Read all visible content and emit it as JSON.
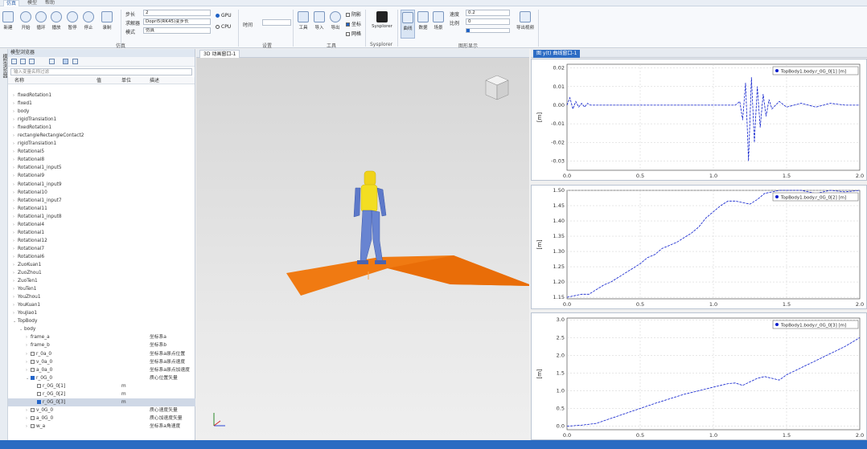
{
  "ribbon": {
    "tabs": [
      "仿真",
      "模型",
      "帮助"
    ],
    "buttons": {
      "new": "新建",
      "start": "开始",
      "loop": "循环",
      "play": "播放",
      "pause": "暂停",
      "stop": "停止",
      "record": "录制"
    },
    "fields": {
      "step_label": "步长",
      "step_value": "2",
      "solver_label": "求解器",
      "solver_value": "Dopri5(RK45)变步长",
      "mode_label": "模式",
      "mode_value": "仿真",
      "time_label": "时间",
      "time_value": ""
    },
    "radios": {
      "gpu": "GPU",
      "cpu": "CPU"
    },
    "mid_buttons": {
      "tools": "工具",
      "import": "导入",
      "export": "导出"
    },
    "checks": [
      "阴影",
      "坐标",
      "网格"
    ],
    "right_buttons": {
      "sysplorer": "Sysplorer",
      "plot": "曲线",
      "data": "数据",
      "scene": "场景"
    },
    "speed_label": "速度",
    "speed_value": "0.2",
    "scale_label": "比例",
    "scale_value": "0",
    "extra_button": "导出视频",
    "groups": [
      "仿真",
      "设置",
      "工具",
      "Sysplorer",
      "图形显示"
    ]
  },
  "tree": {
    "panel_title": "模型浏览器",
    "search_placeholder": "输入变量名称过滤",
    "columns": [
      "名称",
      "值",
      "单位",
      "描述"
    ],
    "rows": [
      {
        "name": "fixedRotation1",
        "indent": 0,
        "arrow": "›"
      },
      {
        "name": "fixed1",
        "indent": 0,
        "arrow": "›"
      },
      {
        "name": "body",
        "indent": 0,
        "arrow": "›"
      },
      {
        "name": "rigidTranslation1",
        "indent": 0,
        "arrow": "›"
      },
      {
        "name": "fixedRotation1",
        "indent": 0,
        "arrow": "›"
      },
      {
        "name": "rectangleRectangleContact2",
        "indent": 0,
        "arrow": "›"
      },
      {
        "name": "rigidTranslation1",
        "indent": 0,
        "arrow": "›"
      },
      {
        "name": "Rotational5",
        "indent": 0,
        "arrow": "›"
      },
      {
        "name": "Rotational8",
        "indent": 0,
        "arrow": "›"
      },
      {
        "name": "Rotational1_input5",
        "indent": 0,
        "arrow": "›"
      },
      {
        "name": "Rotational9",
        "indent": 0,
        "arrow": "›"
      },
      {
        "name": "Rotational1_input9",
        "indent": 0,
        "arrow": "›"
      },
      {
        "name": "Rotational10",
        "indent": 0,
        "arrow": "›"
      },
      {
        "name": "Rotational1_input7",
        "indent": 0,
        "arrow": "›"
      },
      {
        "name": "Rotational11",
        "indent": 0,
        "arrow": "›"
      },
      {
        "name": "Rotational1_input8",
        "indent": 0,
        "arrow": "›"
      },
      {
        "name": "Rotational4",
        "indent": 0,
        "arrow": "›"
      },
      {
        "name": "Rotational1",
        "indent": 0,
        "arrow": "›"
      },
      {
        "name": "Rotational12",
        "indent": 0,
        "arrow": "›"
      },
      {
        "name": "Rotational7",
        "indent": 0,
        "arrow": "›"
      },
      {
        "name": "Rotational6",
        "indent": 0,
        "arrow": "›"
      },
      {
        "name": "ZuoKuan1",
        "indent": 0,
        "arrow": "›"
      },
      {
        "name": "ZuoZhou1",
        "indent": 0,
        "arrow": "›"
      },
      {
        "name": "ZuoTen1",
        "indent": 0,
        "arrow": "›"
      },
      {
        "name": "YouTen1",
        "indent": 0,
        "arrow": "›"
      },
      {
        "name": "YouZhou1",
        "indent": 0,
        "arrow": "›"
      },
      {
        "name": "YouKuan1",
        "indent": 0,
        "arrow": "›"
      },
      {
        "name": "YouJiao1",
        "indent": 0,
        "arrow": "›"
      },
      {
        "name": "TopBody",
        "indent": 0,
        "arrow": "⌄"
      },
      {
        "name": "body",
        "indent": 1,
        "arrow": "⌄"
      },
      {
        "name": "frame_a",
        "indent": 2,
        "arrow": "›",
        "desc": "坐标系a"
      },
      {
        "name": "frame_b",
        "indent": 2,
        "arrow": "›",
        "desc": "坐标系b"
      },
      {
        "name": "r_0a_0",
        "indent": 2,
        "arrow": "›",
        "check": false,
        "desc": "坐标系a原点位置"
      },
      {
        "name": "v_0a_0",
        "indent": 2,
        "arrow": "›",
        "check": false,
        "desc": "坐标系a原点速度"
      },
      {
        "name": "a_0a_0",
        "indent": 2,
        "arrow": "›",
        "check": false,
        "desc": "坐标系a原点加速度"
      },
      {
        "name": "r_0G_0",
        "indent": 2,
        "arrow": "⌄",
        "check": true,
        "desc": "质心位置矢量"
      },
      {
        "name": "r_0G_0[1]",
        "indent": 3,
        "check": false,
        "unit": "m"
      },
      {
        "name": "r_0G_0[2]",
        "indent": 3,
        "check": false,
        "unit": "m"
      },
      {
        "name": "r_0G_0[3]",
        "indent": 3,
        "check": true,
        "unit": "m",
        "selected": true
      },
      {
        "name": "v_0G_0",
        "indent": 2,
        "arrow": "›",
        "check": false,
        "desc": "质心速度矢量"
      },
      {
        "name": "a_0G_0",
        "indent": 2,
        "arrow": "›",
        "check": false,
        "desc": "质心加速度矢量"
      },
      {
        "name": "w_a",
        "indent": 2,
        "arrow": "›",
        "check": false,
        "desc": "坐标系a角速度"
      }
    ]
  },
  "viewport": {
    "tab_label": "3D 动画窗口-1"
  },
  "charts": {
    "tab_label": "图 y(t) 曲线窗口-1",
    "colors": {
      "series": "#0b1dcc",
      "grid": "#cfcfcf",
      "axis": "#333333"
    }
  },
  "chart_data": [
    {
      "type": "line",
      "title": "",
      "ylabel": "[m]",
      "xlim": [
        0,
        2.0
      ],
      "ylim": [
        -0.035,
        0.022
      ],
      "xticks": [
        "0.0",
        "0.5",
        "1.0",
        "1.5",
        "2.0"
      ],
      "yticks": [
        "0.02",
        "0.01",
        "0.00",
        "-0.01",
        "-0.02",
        "-0.03"
      ],
      "ytick_values": [
        0.02,
        0.01,
        0.0,
        -0.01,
        -0.02,
        -0.03
      ],
      "legend": "TopBody1.body.r_0G_0[1] [m]",
      "legend_position": "top-right",
      "grid": true,
      "series": [
        {
          "name": "TopBody1.body.r_0G_0[1] [m]",
          "x": [
            0,
            0.02,
            0.04,
            0.06,
            0.08,
            0.1,
            0.12,
            0.14,
            0.16,
            0.2,
            0.25,
            0.3,
            0.4,
            0.5,
            0.6,
            0.8,
            1.0,
            1.1,
            1.15,
            1.18,
            1.2,
            1.22,
            1.24,
            1.26,
            1.28,
            1.3,
            1.32,
            1.34,
            1.36,
            1.38,
            1.4,
            1.45,
            1.5,
            1.6,
            1.7,
            1.8,
            1.9,
            2.0
          ],
          "values": [
            0.0,
            0.004,
            -0.002,
            0.002,
            -0.001,
            0.001,
            -0.001,
            0.001,
            0.0,
            0.0,
            0.0,
            0.0,
            0.0,
            0.0,
            0.0,
            0.0,
            0.0,
            0.0,
            0.0,
            0.002,
            -0.008,
            0.012,
            -0.03,
            0.015,
            -0.02,
            0.01,
            -0.012,
            0.006,
            -0.006,
            0.003,
            -0.002,
            0.002,
            -0.001,
            0.001,
            -0.001,
            0.001,
            0.0,
            0.0
          ]
        }
      ]
    },
    {
      "type": "line",
      "title": "",
      "ylabel": "[m]",
      "xlim": [
        0,
        2.0
      ],
      "ylim": [
        1.145,
        1.5
      ],
      "xticks": [
        "0.0",
        "0.5",
        "1.0",
        "1.5",
        "2.0"
      ],
      "yticks": [
        "1.50",
        "1.45",
        "1.40",
        "1.35",
        "1.30",
        "1.25",
        "1.20",
        "1.15"
      ],
      "ytick_values": [
        1.5,
        1.45,
        1.4,
        1.35,
        1.3,
        1.25,
        1.2,
        1.15
      ],
      "legend": "TopBody1.body.r_0G_0[2] [m]",
      "legend_position": "top-right",
      "grid": true,
      "series": [
        {
          "name": "TopBody1.body.r_0G_0[2] [m]",
          "x": [
            0,
            0.05,
            0.1,
            0.15,
            0.2,
            0.25,
            0.3,
            0.35,
            0.4,
            0.45,
            0.5,
            0.55,
            0.6,
            0.65,
            0.7,
            0.75,
            0.8,
            0.85,
            0.9,
            0.95,
            1.0,
            1.05,
            1.1,
            1.15,
            1.2,
            1.25,
            1.3,
            1.35,
            1.4,
            1.45,
            1.5,
            1.6,
            1.7,
            1.8,
            1.9,
            2.0
          ],
          "values": [
            1.15,
            1.155,
            1.16,
            1.16,
            1.175,
            1.19,
            1.2,
            1.215,
            1.23,
            1.245,
            1.26,
            1.28,
            1.29,
            1.31,
            1.32,
            1.33,
            1.345,
            1.36,
            1.38,
            1.41,
            1.43,
            1.45,
            1.465,
            1.465,
            1.46,
            1.455,
            1.47,
            1.49,
            1.495,
            1.5,
            1.5,
            1.5,
            1.49,
            1.5,
            1.495,
            1.5
          ]
        }
      ]
    },
    {
      "type": "line",
      "title": "",
      "ylabel": "[m]",
      "xlim": [
        0,
        2.0
      ],
      "ylim": [
        -0.1,
        3.05
      ],
      "xticks": [
        "0.0",
        "0.5",
        "1.0",
        "1.5",
        "2.0"
      ],
      "yticks": [
        "3.0",
        "2.5",
        "2.0",
        "1.5",
        "1.0",
        "0.5",
        "0.0"
      ],
      "ytick_values": [
        3.0,
        2.5,
        2.0,
        1.5,
        1.0,
        0.5,
        0.0
      ],
      "legend": "TopBody1.body.r_0G_0[3] [m]",
      "legend_position": "top-right",
      "grid": true,
      "series": [
        {
          "name": "TopBody1.body.r_0G_0[3] [m]",
          "x": [
            0,
            0.1,
            0.2,
            0.3,
            0.4,
            0.5,
            0.6,
            0.7,
            0.8,
            0.9,
            1.0,
            1.05,
            1.1,
            1.15,
            1.2,
            1.25,
            1.3,
            1.35,
            1.4,
            1.45,
            1.5,
            1.55,
            1.6,
            1.7,
            1.8,
            1.9,
            2.0
          ],
          "values": [
            0.0,
            0.03,
            0.08,
            0.22,
            0.36,
            0.5,
            0.64,
            0.77,
            0.9,
            1.0,
            1.1,
            1.15,
            1.2,
            1.22,
            1.15,
            1.25,
            1.35,
            1.4,
            1.35,
            1.3,
            1.45,
            1.55,
            1.65,
            1.85,
            2.05,
            2.25,
            2.5
          ]
        }
      ]
    }
  ]
}
